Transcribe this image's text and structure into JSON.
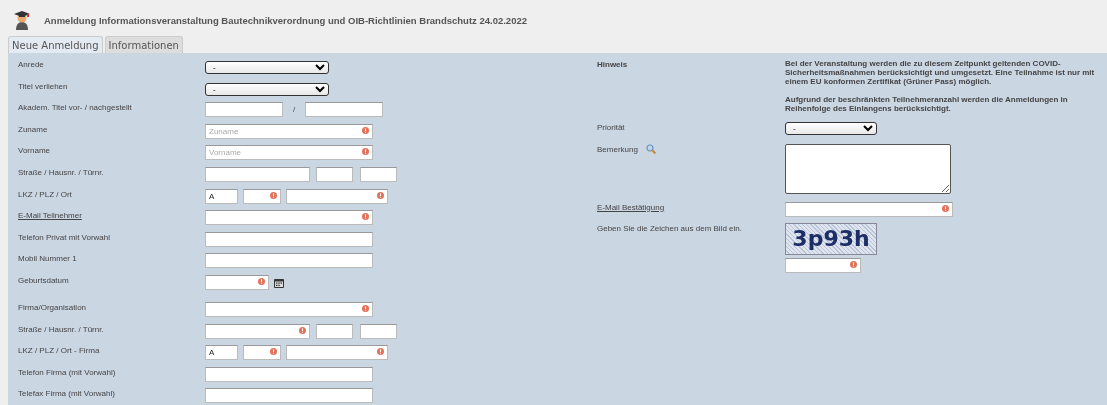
{
  "window": {
    "title": "Anmeldung Informationsveranstaltung Bautechnikverordnung und OIB-Richtlinien Brandschutz 24.02.2022"
  },
  "tabs": [
    {
      "label": "Neue Anmeldung",
      "selected": true
    },
    {
      "label": "Informationen",
      "selected": false
    }
  ],
  "left_rows": [
    {
      "kind": "select",
      "label": "Anrede",
      "link": false,
      "fields": [
        {
          "kind": "select",
          "value": "-",
          "required": false
        }
      ]
    },
    {
      "kind": "select",
      "label": "Titel verliehen",
      "link": false,
      "fields": [
        {
          "kind": "select",
          "value": "-",
          "required": false
        }
      ]
    },
    {
      "kind": "pair",
      "label": "Akadem. Titel vor- / nachgestellt",
      "link": false,
      "separator": "/",
      "fields": [
        {
          "kind": "text",
          "required": false
        },
        {
          "kind": "text",
          "required": false
        }
      ]
    },
    {
      "kind": "single",
      "label": "Zuname",
      "link": false,
      "fields": [
        {
          "kind": "text",
          "placeholder": "Zuname",
          "required": true
        }
      ]
    },
    {
      "kind": "single",
      "label": "Vorname",
      "link": false,
      "fields": [
        {
          "kind": "text",
          "placeholder": "Vorname",
          "required": true
        }
      ]
    },
    {
      "kind": "address",
      "label": "Straße / Hausnr. / Türnr.",
      "link": false,
      "fields": [
        {
          "kind": "text",
          "required": false
        },
        {
          "kind": "text",
          "required": false
        },
        {
          "kind": "text",
          "required": false
        }
      ]
    },
    {
      "kind": "location",
      "label": "LKZ / PLZ / Ort",
      "link": false,
      "fields": [
        {
          "kind": "text",
          "value": "A",
          "required": false
        },
        {
          "kind": "text",
          "required": true
        },
        {
          "kind": "text",
          "required": true
        }
      ]
    },
    {
      "kind": "single",
      "label": "E-Mail Teilnehmer",
      "link": true,
      "fields": [
        {
          "kind": "text",
          "required": true
        }
      ]
    },
    {
      "kind": "single",
      "label": "Telefon Privat mit Vorwahl",
      "link": false,
      "fields": [
        {
          "kind": "text",
          "required": false
        }
      ]
    },
    {
      "kind": "single",
      "label": "Mobil Nummer 1",
      "link": false,
      "fields": [
        {
          "kind": "text",
          "required": false
        }
      ]
    },
    {
      "kind": "date",
      "label": "Geburtsdatum",
      "link": false,
      "fields": [
        {
          "kind": "date",
          "required": true
        }
      ]
    },
    {
      "kind": "single",
      "label": "Firma/Organisation",
      "link": false,
      "fields": [
        {
          "kind": "text",
          "required": true
        }
      ]
    },
    {
      "kind": "address",
      "label": "Straße / Hausnr. / Türnr.",
      "link": false,
      "fields": [
        {
          "kind": "text",
          "required": true
        },
        {
          "kind": "text",
          "required": false
        },
        {
          "kind": "text",
          "required": false
        }
      ]
    },
    {
      "kind": "location",
      "label": "LKZ / PLZ / Ort - Firma",
      "link": false,
      "fields": [
        {
          "kind": "text",
          "value": "A",
          "required": false
        },
        {
          "kind": "text",
          "required": true
        },
        {
          "kind": "text",
          "required": true
        }
      ]
    },
    {
      "kind": "single",
      "label": "Telefon Firma (mit Vorwahl)",
      "link": false,
      "fields": [
        {
          "kind": "text",
          "required": false
        }
      ]
    },
    {
      "kind": "single",
      "label": "Telefax Firma (mit Vorwahl)",
      "link": false,
      "fields": [
        {
          "kind": "text",
          "required": false
        }
      ]
    }
  ],
  "right_rows": [
    {
      "kind": "note",
      "label": "Hinweis",
      "paragraphs": [
        "Bei der Veranstaltung werden die zu diesem Zeitpunkt geltenden COVID-Sicherheitsmaßnahmen berücksichtigt und umgesetzt. Eine Teilnahme ist nur mit einem EU konformen Zertifikat (Grüner Pass) möglich.",
        "Aufgrund der beschränkten Teilnehmeranzahl werden die Anmeldungen in Reihenfolge des Einlangens berücksichtigt."
      ]
    },
    {
      "kind": "select",
      "label": "Priorität",
      "link": false,
      "value": "-"
    },
    {
      "kind": "textarea",
      "label": "Bemerkung",
      "link": false
    },
    {
      "kind": "text",
      "label": "E-Mail Bestätigung",
      "link": true,
      "required": true
    },
    {
      "kind": "captcha",
      "label": "Geben Sie die Zeichen aus dem Bild ein.",
      "link": false,
      "captcha": "3p93h",
      "required": true
    }
  ]
}
